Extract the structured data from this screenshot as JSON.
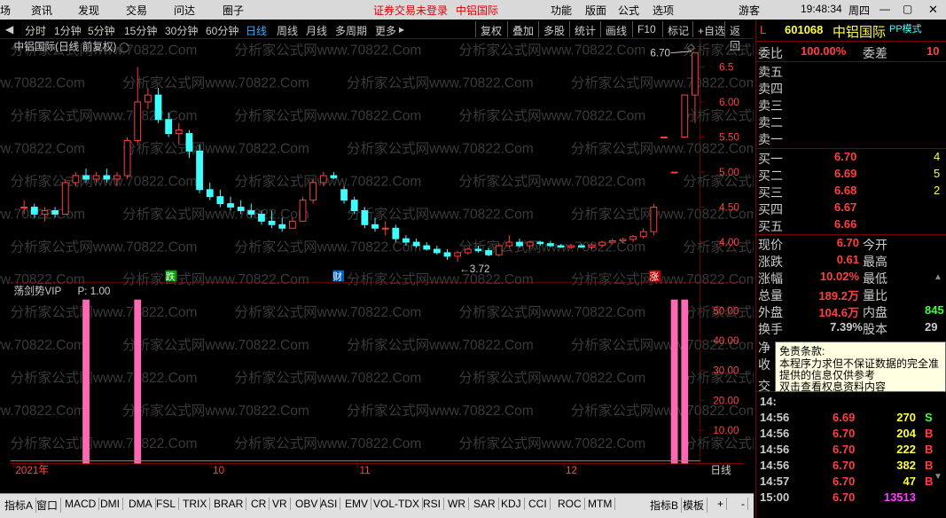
{
  "menu": {
    "items": [
      "场",
      "资讯",
      "发现",
      "交易",
      "问达",
      "圈子"
    ],
    "status1": "证券交易未登录",
    "status2": "中铝国际",
    "right_items": [
      "功能",
      "版面",
      "公式",
      "选项"
    ],
    "user": "游客",
    "time": "19:48:34",
    "weekday": "周四"
  },
  "periods": [
    "分时",
    "1分钟",
    "5分钟",
    "15分钟",
    "30分钟",
    "60分钟",
    "日线",
    "周线",
    "月线",
    "多周期",
    "更多"
  ],
  "selected_period": "日线",
  "right_buttons": [
    "复权",
    "叠加",
    "多股",
    "统计",
    "画线",
    "F10",
    "标记",
    "+自选",
    "返回"
  ],
  "chart_title": "中铝国际(日线 前复权)",
  "price_labels": [
    "6.5",
    "6.00",
    "5.50",
    "5.00",
    "4.50",
    "4.00"
  ],
  "indicator_title": "荡剑势VIP",
  "indicator_param": "P: 1.00",
  "indicator_labels": [
    "50.00",
    "40.00",
    "30.00",
    "20.00",
    "10.00"
  ],
  "annotations": {
    "high": "6.70",
    "low": "3.72",
    "m1": "跌",
    "m2": "财",
    "m3": "涨"
  },
  "watermark": "分析家公式网www.70822.Com",
  "x_labels": [
    "2021年",
    "10",
    "11",
    "12"
  ],
  "x_unit": "日线",
  "chart_data": {
    "type": "candlestick",
    "title": "中铝国际(日线 前复权)",
    "candles": [
      [
        4.5,
        4.6,
        4.4,
        4.5
      ],
      [
        4.5,
        4.55,
        4.35,
        4.4
      ],
      [
        4.4,
        4.5,
        4.3,
        4.45
      ],
      [
        4.45,
        4.5,
        4.35,
        4.4
      ],
      [
        4.4,
        4.9,
        4.4,
        4.85
      ],
      [
        4.85,
        5.0,
        4.8,
        4.95
      ],
      [
        4.95,
        5.05,
        4.85,
        4.9
      ],
      [
        4.9,
        5.0,
        4.85,
        4.95
      ],
      [
        4.95,
        5.05,
        4.85,
        4.9
      ],
      [
        4.9,
        5.0,
        4.8,
        4.95
      ],
      [
        4.95,
        5.5,
        4.9,
        5.45
      ],
      [
        5.45,
        6.5,
        5.4,
        6.0
      ],
      [
        6.0,
        6.2,
        5.9,
        6.1
      ],
      [
        6.1,
        6.2,
        5.7,
        5.75
      ],
      [
        5.75,
        5.85,
        5.5,
        5.55
      ],
      [
        5.55,
        5.7,
        5.4,
        5.6
      ],
      [
        5.55,
        5.6,
        5.2,
        5.3
      ],
      [
        5.3,
        5.4,
        4.7,
        4.75
      ],
      [
        4.75,
        4.85,
        4.6,
        4.65
      ],
      [
        4.65,
        4.75,
        4.5,
        4.55
      ],
      [
        4.55,
        4.65,
        4.45,
        4.5
      ],
      [
        4.5,
        4.6,
        4.4,
        4.45
      ],
      [
        4.45,
        4.55,
        4.35,
        4.4
      ],
      [
        4.4,
        4.45,
        4.25,
        4.3
      ],
      [
        4.3,
        4.45,
        4.2,
        4.25
      ],
      [
        4.25,
        4.35,
        4.15,
        4.2
      ],
      [
        4.2,
        4.35,
        4.2,
        4.3
      ],
      [
        4.3,
        4.65,
        4.3,
        4.6
      ],
      [
        4.6,
        4.9,
        4.55,
        4.85
      ],
      [
        4.85,
        5.0,
        4.8,
        4.95
      ],
      [
        4.95,
        5.0,
        4.9,
        4.92
      ],
      [
        4.75,
        4.8,
        4.55,
        4.6
      ],
      [
        4.6,
        4.65,
        4.4,
        4.45
      ],
      [
        4.45,
        4.5,
        4.2,
        4.25
      ],
      [
        4.25,
        4.35,
        4.15,
        4.2
      ],
      [
        4.2,
        4.3,
        4.1,
        4.2
      ],
      [
        4.2,
        4.25,
        4.0,
        4.05
      ],
      [
        4.05,
        4.1,
        3.95,
        4.0
      ],
      [
        4.0,
        4.05,
        3.92,
        3.95
      ],
      [
        3.95,
        4.0,
        3.88,
        3.9
      ],
      [
        3.9,
        3.95,
        3.82,
        3.85
      ],
      [
        3.85,
        3.9,
        3.75,
        3.8
      ],
      [
        3.8,
        3.88,
        3.72,
        3.85
      ],
      [
        3.85,
        3.92,
        3.82,
        3.9
      ],
      [
        3.9,
        3.95,
        3.85,
        3.88
      ],
      [
        3.88,
        3.92,
        3.8,
        3.82
      ],
      [
        3.82,
        3.98,
        3.8,
        3.95
      ],
      [
        3.95,
        4.1,
        3.92,
        4.0
      ],
      [
        4.0,
        4.05,
        3.92,
        3.95
      ],
      [
        3.95,
        4.02,
        3.9,
        4.0
      ],
      [
        4.0,
        4.02,
        3.95,
        3.98
      ],
      [
        3.98,
        4.02,
        3.93,
        3.95
      ],
      [
        3.95,
        3.97,
        3.92,
        3.93
      ],
      [
        3.93,
        3.97,
        3.9,
        3.95
      ],
      [
        3.95,
        3.98,
        3.92,
        3.93
      ],
      [
        3.93,
        3.98,
        3.9,
        3.96
      ],
      [
        3.96,
        4.02,
        3.93,
        4.0
      ],
      [
        4.0,
        4.05,
        3.97,
        4.02
      ],
      [
        4.02,
        4.06,
        3.98,
        4.04
      ],
      [
        4.04,
        4.1,
        4.0,
        4.08
      ],
      [
        4.08,
        4.2,
        4.05,
        4.15
      ],
      [
        4.15,
        4.55,
        4.1,
        4.5
      ],
      [
        5.5,
        5.5,
        5.5,
        5.5
      ],
      [
        5.0,
        5.0,
        5.0,
        5.0
      ],
      [
        5.5,
        6.1,
        5.5,
        6.1
      ],
      [
        6.1,
        6.7,
        5.7,
        6.7
      ]
    ],
    "signal_bars": [
      6,
      11,
      63,
      64
    ],
    "ylim": [
      3.6,
      6.8
    ]
  },
  "quote": {
    "code": "601068",
    "name": "中铝国际",
    "mode": "PP模式",
    "webi_label": "委比",
    "webi": "100.00%",
    "weicha_label": "委差",
    "weicha": "10",
    "sells": [
      "卖五",
      "卖四",
      "卖三",
      "卖二",
      "卖一"
    ],
    "buys": [
      {
        "l": "买一",
        "p": "6.70",
        "v": "4"
      },
      {
        "l": "买二",
        "p": "6.69",
        "v": "5"
      },
      {
        "l": "买三",
        "p": "6.68",
        "v": "2"
      },
      {
        "l": "买四",
        "p": "6.67",
        "v": ""
      },
      {
        "l": "买五",
        "p": "6.66",
        "v": ""
      }
    ],
    "stats": [
      {
        "l": "现价",
        "v": "6.70",
        "l2": "今开"
      },
      {
        "l": "涨跌",
        "v": "0.61",
        "l2": "最高"
      },
      {
        "l": "涨幅",
        "v": "10.02%",
        "l2": "最低"
      },
      {
        "l": "总量",
        "v": "189.2万",
        "l2": "量比"
      },
      {
        "l": "外盘",
        "v": "104.6万",
        "l2": "内盘",
        "v2": "845"
      },
      {
        "l": "换手",
        "v": "7.39%",
        "l2": "股本",
        "v2": "29"
      }
    ],
    "jing": "净",
    "shou": "收",
    "jiao": "交",
    "ticks": [
      {
        "t": "14:",
        "p": "",
        "v": "",
        "d": ""
      },
      {
        "t": "14:56",
        "p": "6.69",
        "v": "270",
        "d": "S"
      },
      {
        "t": "14:56",
        "p": "6.70",
        "v": "204",
        "d": "B"
      },
      {
        "t": "14:56",
        "p": "6.70",
        "v": "222",
        "d": "B"
      },
      {
        "t": "14:56",
        "p": "6.70",
        "v": "382",
        "d": "B"
      },
      {
        "t": "14:57",
        "p": "6.70",
        "v": "47",
        "d": "B"
      },
      {
        "t": "15:00",
        "p": "6.70",
        "v": "13513",
        "d": ""
      }
    ]
  },
  "tooltip": {
    "title": "免责条款:",
    "line1": "本程序力求但不保证数据的完全准",
    "line2": "提供的信息仅供参考",
    "line3": "双击查看权息资料内容"
  },
  "bottom_tabs": [
    "指标A",
    "窗口",
    "MACD",
    "DMI",
    "DMA",
    "FSL",
    "TRIX",
    "BRAR",
    "CR",
    "VR",
    "OBV",
    "ASI",
    "EMV",
    "VOL-TDX",
    "RSI",
    "WR",
    "SAR",
    "KDJ",
    "CCI",
    "ROC",
    "MTM",
    "指标B",
    "模板",
    "+",
    "-"
  ]
}
